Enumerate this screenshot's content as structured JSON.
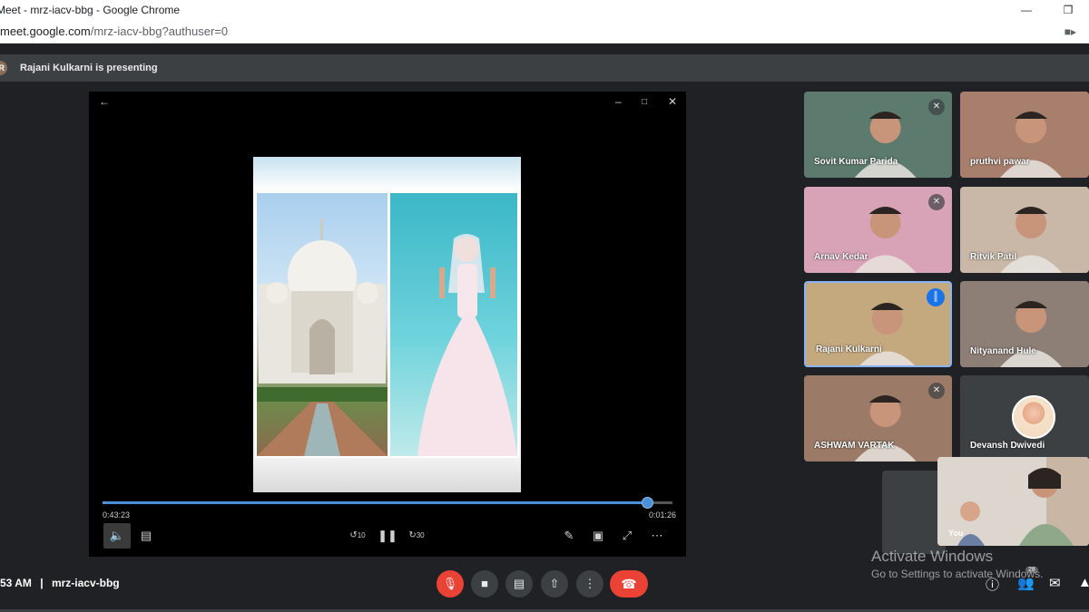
{
  "window": {
    "title": "Meet - mrz-iacv-bbg - Google Chrome",
    "url_host": "meet.google.com",
    "url_path": "/mrz-iacv-bbg?authuser=0"
  },
  "presenting": {
    "initial": "R",
    "text": "Rajani Kulkarni is presenting"
  },
  "player": {
    "elapsed": "0:43:23",
    "remaining": "0:01:26",
    "progress_fraction": 0.955,
    "rewind_label": "10",
    "forward_label": "30"
  },
  "participants": [
    {
      "name": "Sovit Kumar Parida",
      "bg": "#5c7a6e"
    },
    {
      "name": "pruthvi pawar",
      "bg": "#a77f6c"
    },
    {
      "name": "Arnav Kedar",
      "bg": "#d9a3b7"
    },
    {
      "name": "Ritvik Patil",
      "bg": "#c9b8a8"
    },
    {
      "name": "Rajani Kulkarni",
      "bg": "#c5a97e"
    },
    {
      "name": "Nityanand Hule",
      "bg": "#8d7e76"
    },
    {
      "name": "ASHWAM VARTAK",
      "bg": "#9b7b67"
    },
    {
      "name": "Devansh Dwivedi",
      "bg": "#3c4043"
    }
  ],
  "self": {
    "label": "You"
  },
  "meeting": {
    "time": "53 AM",
    "separator": "|",
    "code": "mrz-iacv-bbg"
  },
  "badge_count": "28",
  "watermark": {
    "line1": "Activate Windows",
    "line2": "Go to Settings to activate Windows."
  },
  "colors": {
    "accent": "#1a73e8",
    "end_call": "#ea4335",
    "progress": "#4a90d9"
  }
}
